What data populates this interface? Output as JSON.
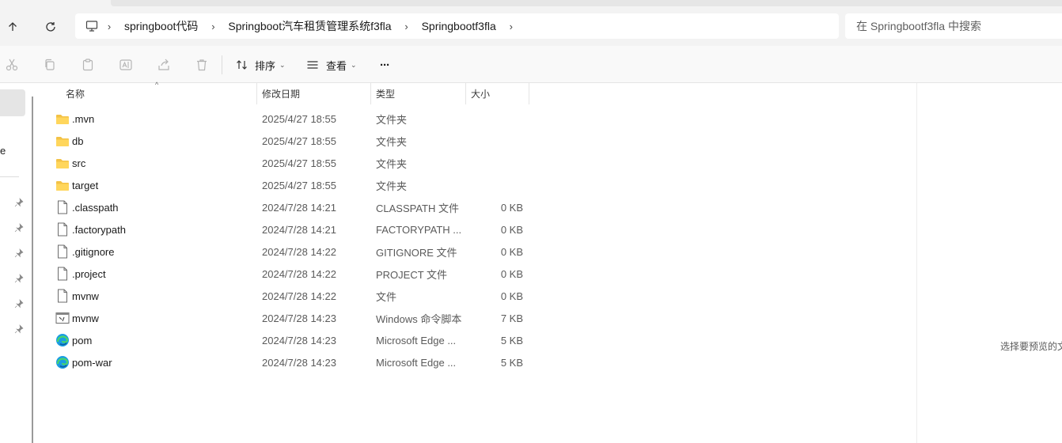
{
  "navbar": {
    "breadcrumbs": [
      "springboot代码",
      "Springboot汽车租赁管理系统f3fla",
      "Springbootf3fla"
    ],
    "search_placeholder": "在 Springbootf3fla 中搜索"
  },
  "toolbar": {
    "sort_label": "排序",
    "view_label": "查看",
    "more_label": "···"
  },
  "sidebar": {
    "fragment": "e"
  },
  "columns": {
    "name": "名称",
    "date": "修改日期",
    "type": "类型",
    "size": "大小"
  },
  "files": [
    {
      "name": ".mvn",
      "date": "2025/4/27 18:55",
      "type": "文件夹",
      "size": "",
      "icon": "folder-icon"
    },
    {
      "name": "db",
      "date": "2025/4/27 18:55",
      "type": "文件夹",
      "size": "",
      "icon": "folder-icon"
    },
    {
      "name": "src",
      "date": "2025/4/27 18:55",
      "type": "文件夹",
      "size": "",
      "icon": "folder-icon"
    },
    {
      "name": "target",
      "date": "2025/4/27 18:55",
      "type": "文件夹",
      "size": "",
      "icon": "folder-icon"
    },
    {
      "name": ".classpath",
      "date": "2024/7/28 14:21",
      "type": "CLASSPATH 文件",
      "size": "0 KB",
      "icon": "file-icon"
    },
    {
      "name": ".factorypath",
      "date": "2024/7/28 14:21",
      "type": "FACTORYPATH ...",
      "size": "0 KB",
      "icon": "file-icon"
    },
    {
      "name": ".gitignore",
      "date": "2024/7/28 14:22",
      "type": "GITIGNORE 文件",
      "size": "0 KB",
      "icon": "file-icon"
    },
    {
      "name": ".project",
      "date": "2024/7/28 14:22",
      "type": "PROJECT 文件",
      "size": "0 KB",
      "icon": "file-icon"
    },
    {
      "name": "mvnw",
      "date": "2024/7/28 14:22",
      "type": "文件",
      "size": "0 KB",
      "icon": "file-icon"
    },
    {
      "name": "mvnw",
      "date": "2024/7/28 14:23",
      "type": "Windows 命令脚本",
      "size": "7 KB",
      "icon": "script-icon"
    },
    {
      "name": "pom",
      "date": "2024/7/28 14:23",
      "type": "Microsoft Edge ...",
      "size": "5 KB",
      "icon": "edge-icon"
    },
    {
      "name": "pom-war",
      "date": "2024/7/28 14:23",
      "type": "Microsoft Edge ...",
      "size": "5 KB",
      "icon": "edge-icon"
    }
  ],
  "preview": {
    "text": "选择要预览的文"
  }
}
